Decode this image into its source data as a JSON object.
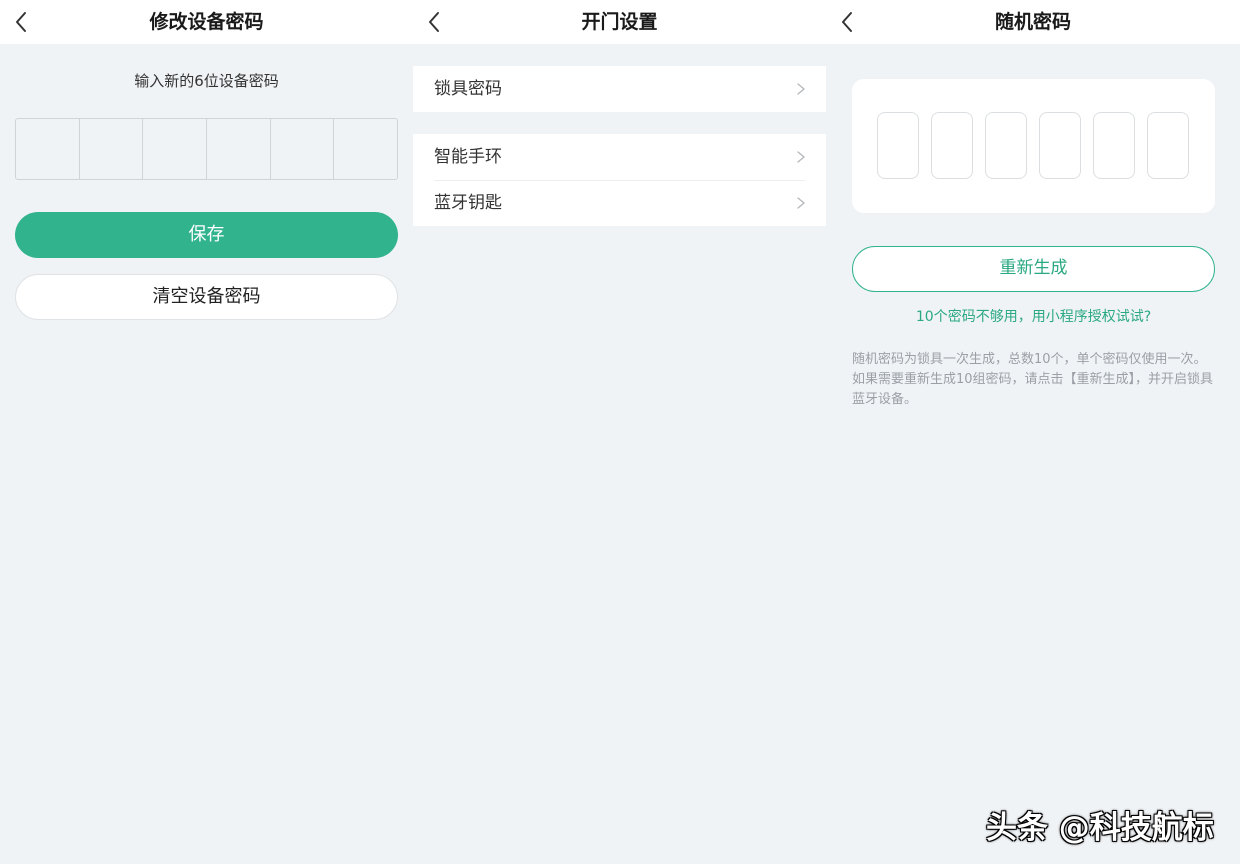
{
  "screen1": {
    "title": "修改设备密码",
    "prompt": "输入新的6位设备密码",
    "pin_length": 6,
    "save_label": "保存",
    "clear_label": "清空设备密码"
  },
  "screen2": {
    "title": "开门设置",
    "group1": [
      {
        "label": "锁具密码"
      }
    ],
    "group2": [
      {
        "label": "智能手环"
      },
      {
        "label": "蓝牙钥匙"
      }
    ]
  },
  "screen3": {
    "title": "随机密码",
    "code_slots": 6,
    "regenerate_label": "重新生成",
    "mini_program_link": "10个密码不够用，用小程序授权试试?",
    "description": "随机密码为锁具一次生成，总数10个，单个密码仅使用一次。如果需要重新生成10组密码，请点击【重新生成】，并开启锁具蓝牙设备。"
  },
  "watermark": "头条 @科技航标",
  "colors": {
    "accent": "#31b38e",
    "accent_text": "#2aa882",
    "background": "#f0f3f6",
    "surface": "#ffffff"
  },
  "icons": {
    "back": "chevron-left-icon",
    "row": "chevron-right-icon"
  }
}
